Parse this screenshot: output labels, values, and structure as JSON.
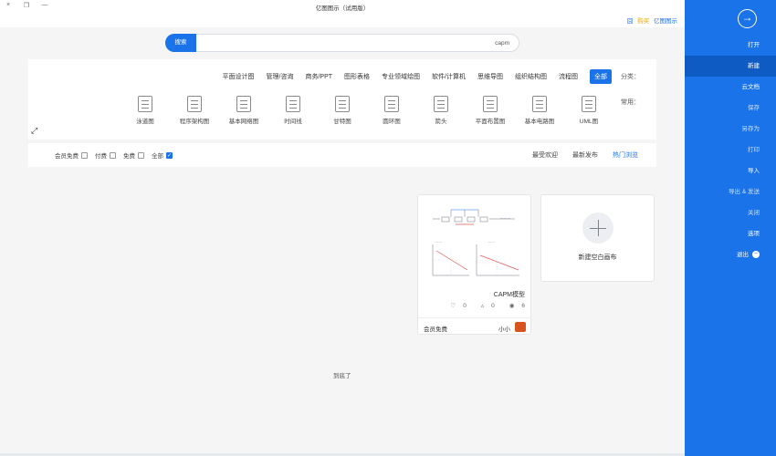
{
  "window": {
    "title": "亿图图示（试用版）",
    "btn_close": "×",
    "btn_restore": "❐",
    "btn_min": "—"
  },
  "brand": {
    "icon": "囧",
    "part1": "购买",
    "part2": "亿图图示"
  },
  "search": {
    "button": "搜索",
    "value": "capm"
  },
  "categories": {
    "label": "分类：",
    "items": [
      "全部",
      "流程图",
      "组织结构图",
      "思维导图",
      "软件/计算机",
      "专业领域绘图",
      "图形表格",
      "商务/PPT",
      "管理/咨询",
      "平面设计图"
    ],
    "active_index": 0
  },
  "common": {
    "label": "常用：",
    "items": [
      "UML图",
      "基本电路图",
      "平面布置图",
      "箭头",
      "圆环图",
      "甘特图",
      "时间线",
      "基本网络图",
      "程序架构图",
      "泳道图"
    ]
  },
  "expand_icon": "⤢",
  "tabs": {
    "items": [
      "热门浏览",
      "最新发布",
      "最受欢迎"
    ],
    "active_index": 0
  },
  "filters": {
    "items": [
      {
        "label": "全部",
        "checked": true
      },
      {
        "label": "免费",
        "checked": false
      },
      {
        "label": "付费",
        "checked": false
      },
      {
        "label": "会员免费",
        "checked": false
      }
    ]
  },
  "new_canvas": {
    "label": "新建空白画布"
  },
  "template": {
    "name": "CAPM模型",
    "views": "6",
    "likes": "0",
    "favorites": "0",
    "author": "小小",
    "price": "会员免费"
  },
  "end_text": "到底了",
  "sidebar": {
    "back_icon": "→",
    "items": [
      {
        "label": "打开",
        "state": "normal"
      },
      {
        "label": "新建",
        "state": "active"
      },
      {
        "label": "云文档",
        "state": "normal"
      },
      {
        "label": "保存",
        "state": "dim"
      },
      {
        "label": "另存为",
        "state": "dim"
      },
      {
        "label": "打印",
        "state": "dim"
      },
      {
        "label": "导入",
        "state": "normal"
      },
      {
        "label": "导出 & 发送",
        "state": "dim"
      },
      {
        "label": "关闭",
        "state": "dim"
      },
      {
        "label": "选项",
        "state": "normal"
      },
      {
        "label": "退出",
        "state": "normal"
      }
    ]
  },
  "colors": {
    "accent": "#1a73e8",
    "sidebar_active": "#0f5bc4"
  }
}
